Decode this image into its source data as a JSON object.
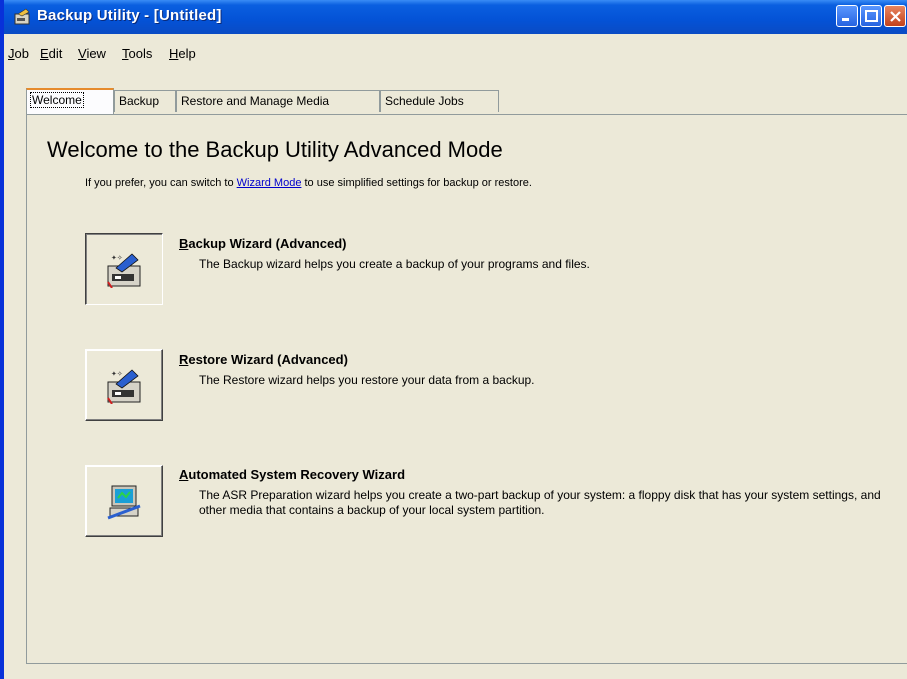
{
  "window": {
    "title": "Backup Utility - [Untitled]"
  },
  "menu": [
    {
      "label": "Job",
      "u": "J",
      "rest": "ob"
    },
    {
      "label": "Edit",
      "u": "E",
      "rest": "dit"
    },
    {
      "label": "View",
      "u": "V",
      "rest": "iew"
    },
    {
      "label": "Tools",
      "u": "T",
      "rest": "ools"
    },
    {
      "label": "Help",
      "u": "H",
      "rest": "elp"
    }
  ],
  "tabs": [
    {
      "label": "Welcome"
    },
    {
      "label": "Backup"
    },
    {
      "label": "Restore and Manage Media"
    },
    {
      "label": "Schedule Jobs"
    }
  ],
  "welcome": {
    "heading": "Welcome to the Backup Utility Advanced Mode",
    "intro_before": "If you prefer, you can switch to ",
    "intro_link": "Wizard Mode",
    "intro_after": " to use simplified settings for backup or restore."
  },
  "wizards": [
    {
      "title_u": "B",
      "title_rest": "ackup Wizard (Advanced)",
      "desc": "The Backup wizard helps you create a backup of your programs and files.",
      "icon": "backup-wizard-icon"
    },
    {
      "title_u": "R",
      "title_rest": "estore Wizard (Advanced)",
      "desc": "The Restore wizard helps you restore your data from a backup.",
      "icon": "restore-wizard-icon"
    },
    {
      "title_u": "A",
      "title_rest": "utomated System Recovery Wizard",
      "desc": "The ASR Preparation wizard helps you create a two-part backup of your system: a floppy disk that has your system settings, and other media that contains a backup of your local system partition.",
      "icon": "asr-wizard-icon"
    }
  ]
}
